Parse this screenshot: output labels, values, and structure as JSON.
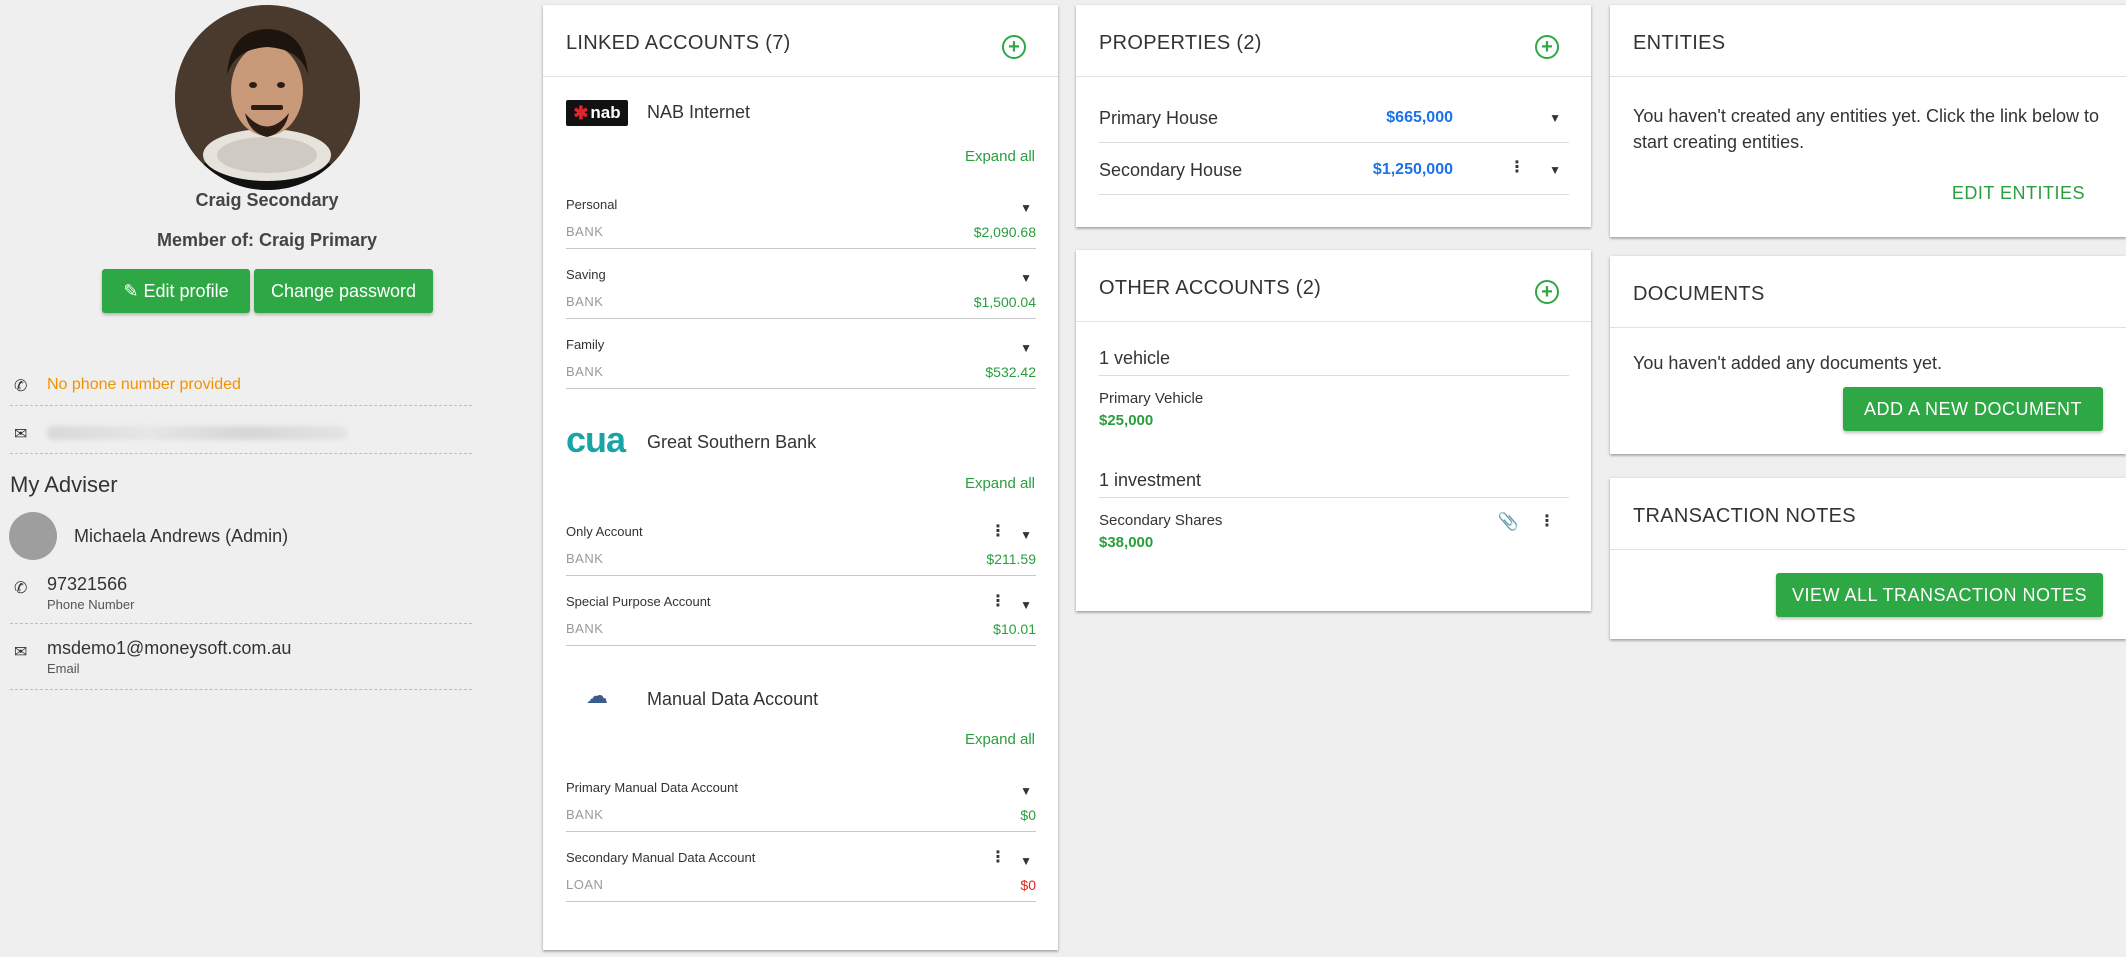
{
  "profile": {
    "name": "Craig Secondary",
    "member_of": "Member of: Craig Primary",
    "edit_profile_label": "Edit profile",
    "change_password_label": "Change password",
    "phone": "No phone number provided"
  },
  "adviser": {
    "title": "My Adviser",
    "name": "Michaela Andrews (Admin)",
    "phone": "97321566",
    "phone_label": "Phone Number",
    "email": "msdemo1@moneysoft.com.au",
    "email_label": "Email"
  },
  "linked_accounts": {
    "title": "LINKED ACCOUNTS (7)",
    "expand_all": "Expand all",
    "banks": [
      {
        "name": "NAB Internet",
        "logo": "nab",
        "accounts": [
          {
            "name": "Personal",
            "type": "BANK",
            "balance": "$2,090.68"
          },
          {
            "name": "Saving",
            "type": "BANK",
            "balance": "$1,500.04"
          },
          {
            "name": "Family",
            "type": "BANK",
            "balance": "$532.42"
          }
        ]
      },
      {
        "name": "Great Southern Bank",
        "logo": "cua",
        "accounts": [
          {
            "name": "Only Account",
            "type": "BANK",
            "balance": "$211.59"
          },
          {
            "name": "Special Purpose Account",
            "type": "BANK",
            "balance": "$10.01"
          }
        ]
      },
      {
        "name": "Manual Data Account",
        "logo": "cloud-upload-icon",
        "accounts": [
          {
            "name": "Primary Manual Data Account",
            "type": "BANK",
            "balance": "$0"
          },
          {
            "name": "Secondary Manual Data Account",
            "type": "LOAN",
            "balance": "$0"
          }
        ]
      }
    ]
  },
  "properties": {
    "title": "PROPERTIES (2)",
    "items": [
      {
        "name": "Primary House",
        "value": "$665,000"
      },
      {
        "name": "Secondary House",
        "value": "$1,250,000"
      }
    ]
  },
  "other_accounts": {
    "title": "OTHER ACCOUNTS (2)",
    "groups": [
      {
        "label": "1 vehicle",
        "item_name": "Primary Vehicle",
        "item_value": "$25,000"
      },
      {
        "label": "1 investment",
        "item_name": "Secondary Shares",
        "item_value": "$38,000"
      }
    ]
  },
  "entities": {
    "title": "ENTITIES",
    "message": "You haven't created any entities yet. Click the link below to start creating entities.",
    "link": "EDIT ENTITIES"
  },
  "documents": {
    "title": "DOCUMENTS",
    "message": "You haven't added any documents yet.",
    "button": "ADD A NEW DOCUMENT"
  },
  "transaction_notes": {
    "title": "TRANSACTION NOTES",
    "button": "VIEW ALL TRANSACTION NOTES"
  },
  "colors": {
    "accent_green": "#2ea844",
    "value_blue": "#1a73e8",
    "warning_orange": "#f39200",
    "negative_red": "#e0261b"
  }
}
